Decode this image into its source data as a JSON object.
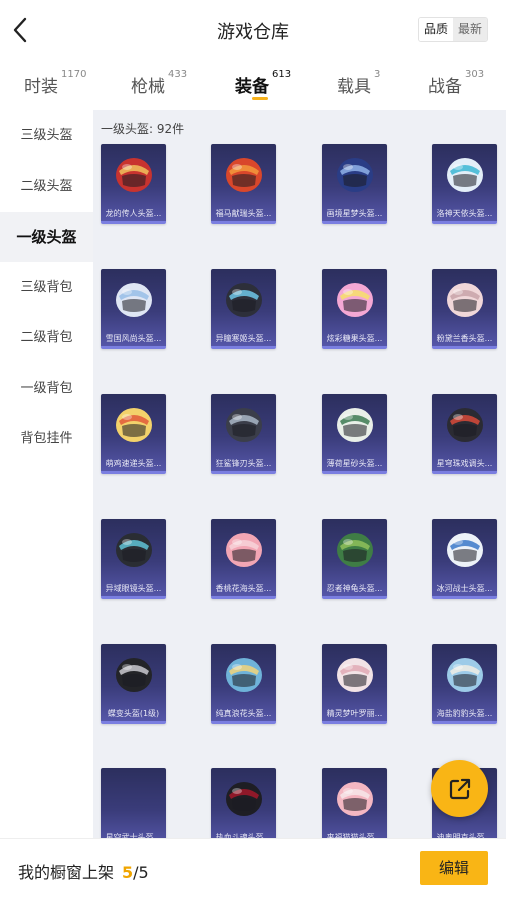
{
  "header": {
    "title": "游戏仓库",
    "sort_quality": "品质",
    "sort_newest": "最新"
  },
  "tabs": [
    {
      "label": "时装",
      "count": "1170"
    },
    {
      "label": "枪械",
      "count": "433"
    },
    {
      "label": "装备",
      "count": "613"
    },
    {
      "label": "载具",
      "count": "3"
    },
    {
      "label": "战备",
      "count": "303"
    }
  ],
  "sidebar": {
    "items": [
      {
        "label": "三级头盔"
      },
      {
        "label": "二级头盔"
      },
      {
        "label": "一级头盔"
      },
      {
        "label": "三级背包"
      },
      {
        "label": "二级背包"
      },
      {
        "label": "一级背包"
      },
      {
        "label": "背包挂件"
      }
    ]
  },
  "content": {
    "count_label": "一级头盔: 92件",
    "items": [
      {
        "name": "龙的传人头盔...",
        "colors": [
          "#c8332f",
          "#f0c25c"
        ]
      },
      {
        "name": "福马献瑞头盔...",
        "colors": [
          "#d9472b",
          "#f29a3c"
        ]
      },
      {
        "name": "画境星梦头盔...",
        "colors": [
          "#2a3d86",
          "#8fb2e8"
        ]
      },
      {
        "name": "洛神天依头盔...",
        "colors": [
          "#e3eef8",
          "#3cb6d3"
        ]
      },
      {
        "name": "雪国风尚头盔...",
        "colors": [
          "#dfe6f4",
          "#98bde6"
        ]
      },
      {
        "name": "异瞳寒姬头盔...",
        "colors": [
          "#2d2f3a",
          "#6ec6e8"
        ]
      },
      {
        "name": "炫彩糖果头盔...",
        "colors": [
          "#f4a8d4",
          "#f6e06a"
        ]
      },
      {
        "name": "粉黛兰香头盔...",
        "colors": [
          "#f0d7d9",
          "#c8a3a8"
        ]
      },
      {
        "name": "萌鸡速递头盔...",
        "colors": [
          "#f3d26b",
          "#e05a3a"
        ]
      },
      {
        "name": "狂鲨锋刃头盔...",
        "colors": [
          "#3b3e4a",
          "#a9b6c6"
        ]
      },
      {
        "name": "薄荷星砂头盔...",
        "colors": [
          "#e9efe8",
          "#3d7a52"
        ]
      },
      {
        "name": "星穹珠戏调头...",
        "colors": [
          "#2b2b33",
          "#d84a3a"
        ]
      },
      {
        "name": "异域眼镜头盔...",
        "colors": [
          "#2a2d33",
          "#5fc3d6"
        ]
      },
      {
        "name": "香桃花海头盔...",
        "colors": [
          "#f2a6b4",
          "#f7d2d8"
        ]
      },
      {
        "name": "忍者神龟头盔...",
        "colors": [
          "#3f7d45",
          "#8fbf5a"
        ]
      },
      {
        "name": "冰河战士头盔...",
        "colors": [
          "#edf2f8",
          "#3b79c9"
        ]
      },
      {
        "name": "蝶变头盔(1级)",
        "colors": [
          "#232428",
          "#c9c9cf"
        ]
      },
      {
        "name": "纯真浪花头盔...",
        "colors": [
          "#6fb3d9",
          "#f1d47a"
        ]
      },
      {
        "name": "精灵梦叶罗丽...",
        "colors": [
          "#f2e3e6",
          "#e1a9b4"
        ]
      },
      {
        "name": "海盐豹豹头盔...",
        "colors": [
          "#9dcbe8",
          "#f0ede4"
        ]
      },
      {
        "name": "星空武士头盔...",
        "colors": [
          "#2c2f5e",
          "#2c2f5e"
        ]
      },
      {
        "name": "热血斗魂头盔...",
        "colors": [
          "#1e1e24",
          "#a3182a"
        ]
      },
      {
        "name": "来福猫猫头盔...",
        "colors": [
          "#f4b7c2",
          "#f6e6e9"
        ]
      },
      {
        "name": "迪奥明克头盔...",
        "colors": [
          "#9fc7e6",
          "#e9f0f6"
        ]
      }
    ]
  },
  "footer": {
    "label": "我的橱窗上架",
    "current": "5",
    "total": "/5",
    "edit_label": "编辑"
  },
  "colors": {
    "accent": "#f9b515",
    "card_bg": "#3a3c7a",
    "card_border": "#7a7ee0",
    "content_bg": "#eef0f5"
  },
  "icons": {
    "back": "chevron-left-icon",
    "share": "share-external-icon"
  }
}
